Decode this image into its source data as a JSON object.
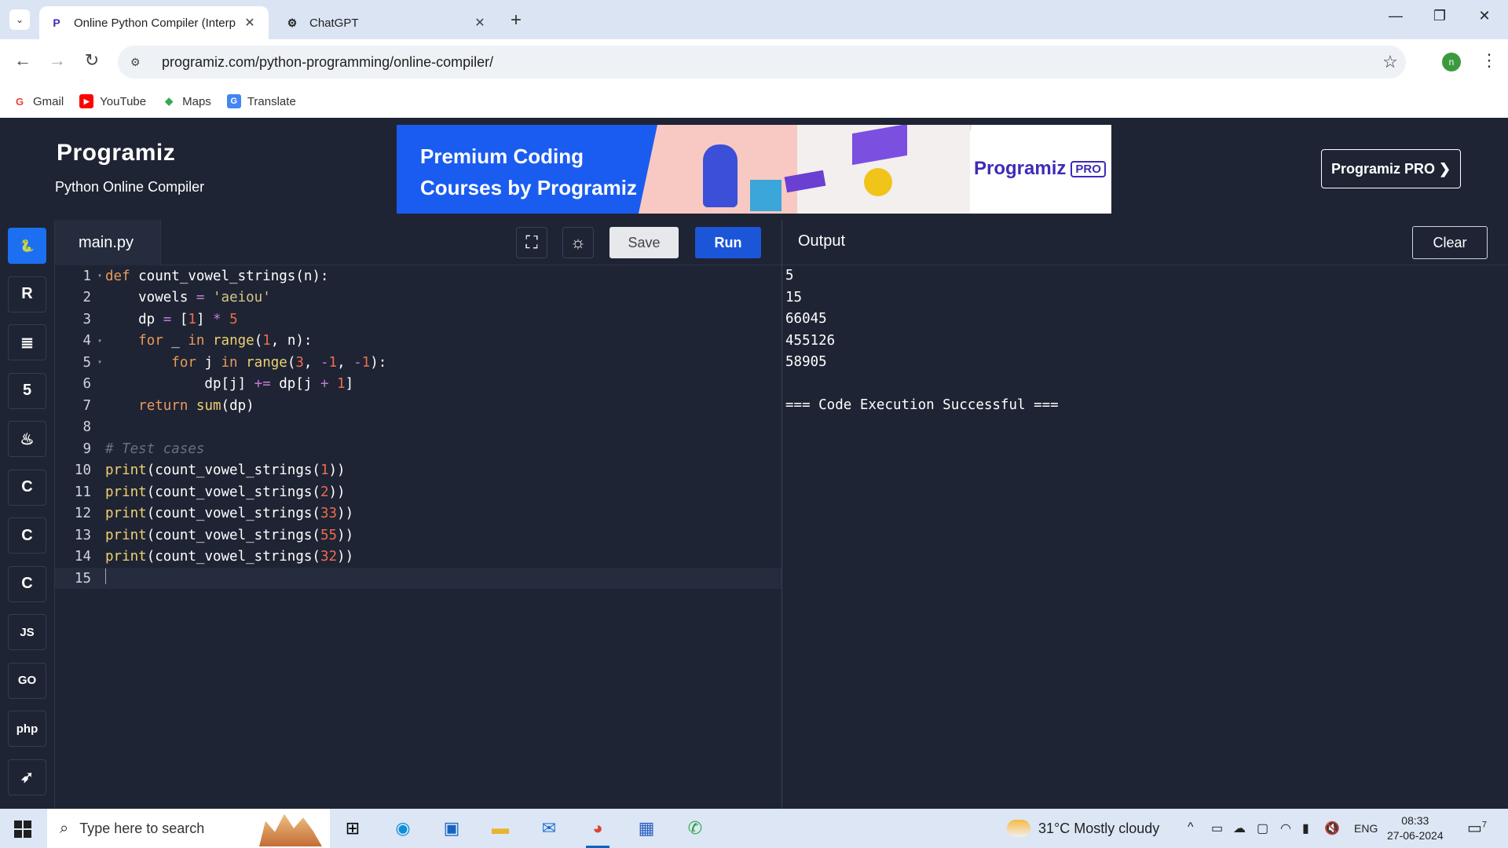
{
  "browser": {
    "tabs": [
      {
        "title": "Online Python Compiler (Interp",
        "favicon": "programiz-icon",
        "active": true
      },
      {
        "title": "ChatGPT",
        "favicon": "chatgpt-icon",
        "active": false
      }
    ],
    "url": "programiz.com/python-programming/online-compiler/",
    "profile_initial": "n",
    "bookmarks": [
      {
        "label": "Gmail",
        "icon": "gmail-icon",
        "color": "#ea4335"
      },
      {
        "label": "YouTube",
        "icon": "youtube-icon",
        "color": "#ff0000"
      },
      {
        "label": "Maps",
        "icon": "maps-icon",
        "color": "#34a853"
      },
      {
        "label": "Translate",
        "icon": "translate-icon",
        "color": "#4285f4"
      }
    ]
  },
  "header": {
    "logo": "Programiz",
    "subtitle": "Python Online Compiler",
    "banner_text_line1": "Premium Coding",
    "banner_text_line2": "Courses by Programiz",
    "banner_logo": "Programiz",
    "banner_badge": "PRO",
    "pro_button": "Programiz PRO ❯"
  },
  "languages": [
    {
      "name": "python",
      "glyph": "🐍",
      "active": true
    },
    {
      "name": "r",
      "glyph": "R",
      "active": false
    },
    {
      "name": "sql",
      "glyph": "≣",
      "active": false
    },
    {
      "name": "html",
      "glyph": "5",
      "active": false
    },
    {
      "name": "java",
      "glyph": "♨",
      "active": false
    },
    {
      "name": "c",
      "glyph": "C",
      "active": false
    },
    {
      "name": "cpp",
      "glyph": "C",
      "active": false
    },
    {
      "name": "csharp",
      "glyph": "C",
      "active": false
    },
    {
      "name": "js",
      "glyph": "JS",
      "active": false
    },
    {
      "name": "go",
      "glyph": "GO",
      "active": false
    },
    {
      "name": "php",
      "glyph": "php",
      "active": false
    },
    {
      "name": "swift",
      "glyph": "➶",
      "active": false
    }
  ],
  "editor": {
    "filename": "main.py",
    "save_label": "Save",
    "run_label": "Run",
    "lines": [
      {
        "n": "1",
        "fold": true,
        "html": "<span class=\"kw\">def</span> count_vowel_strings(n):"
      },
      {
        "n": "2",
        "fold": false,
        "html": "    vowels <span class=\"op\">=</span> <span class=\"str\">'aeiou'</span>"
      },
      {
        "n": "3",
        "fold": false,
        "html": "    dp <span class=\"op\">=</span> [<span class=\"num\">1</span>] <span class=\"op\">*</span> <span class=\"num\">5</span>"
      },
      {
        "n": "4",
        "fold": true,
        "html": "    <span class=\"kw\">for</span> _ <span class=\"kw\">in</span> <span class=\"fn\">range</span>(<span class=\"num\">1</span>, n):"
      },
      {
        "n": "5",
        "fold": true,
        "html": "        <span class=\"kw\">for</span> j <span class=\"kw\">in</span> <span class=\"fn\">range</span>(<span class=\"num\">3</span>, <span class=\"op\">-</span><span class=\"num\">1</span>, <span class=\"op\">-</span><span class=\"num\">1</span>):"
      },
      {
        "n": "6",
        "fold": false,
        "html": "            dp[j] <span class=\"op\">+=</span> dp[j <span class=\"op\">+</span> <span class=\"num\">1</span>]"
      },
      {
        "n": "7",
        "fold": false,
        "html": "    <span class=\"kw\">return</span> <span class=\"fn\">sum</span>(dp)"
      },
      {
        "n": "8",
        "fold": false,
        "html": ""
      },
      {
        "n": "9",
        "fold": false,
        "html": "<span class=\"cm\"># Test cases</span>"
      },
      {
        "n": "10",
        "fold": false,
        "html": "<span class=\"fn\">print</span>(count_vowel_strings(<span class=\"num\">1</span>))"
      },
      {
        "n": "11",
        "fold": false,
        "html": "<span class=\"fn\">print</span>(count_vowel_strings(<span class=\"num\">2</span>))"
      },
      {
        "n": "12",
        "fold": false,
        "html": "<span class=\"fn\">print</span>(count_vowel_strings(<span class=\"num\">33</span>))"
      },
      {
        "n": "13",
        "fold": false,
        "html": "<span class=\"fn\">print</span>(count_vowel_strings(<span class=\"num\">55</span>))"
      },
      {
        "n": "14",
        "fold": false,
        "html": "<span class=\"fn\">print</span>(count_vowel_strings(<span class=\"num\">32</span>))"
      },
      {
        "n": "15",
        "fold": false,
        "html": "",
        "current": true
      }
    ]
  },
  "output": {
    "title": "Output",
    "clear_label": "Clear",
    "lines": [
      "5",
      "15",
      "66045",
      "455126",
      "58905",
      "",
      "=== Code Execution Successful ==="
    ]
  },
  "taskbar": {
    "search_placeholder": "Type here to search",
    "weather": "31°C  Mostly cloudy",
    "language": "ENG",
    "time": "08:33",
    "date": "27-06-2024",
    "notification_count": "7"
  }
}
